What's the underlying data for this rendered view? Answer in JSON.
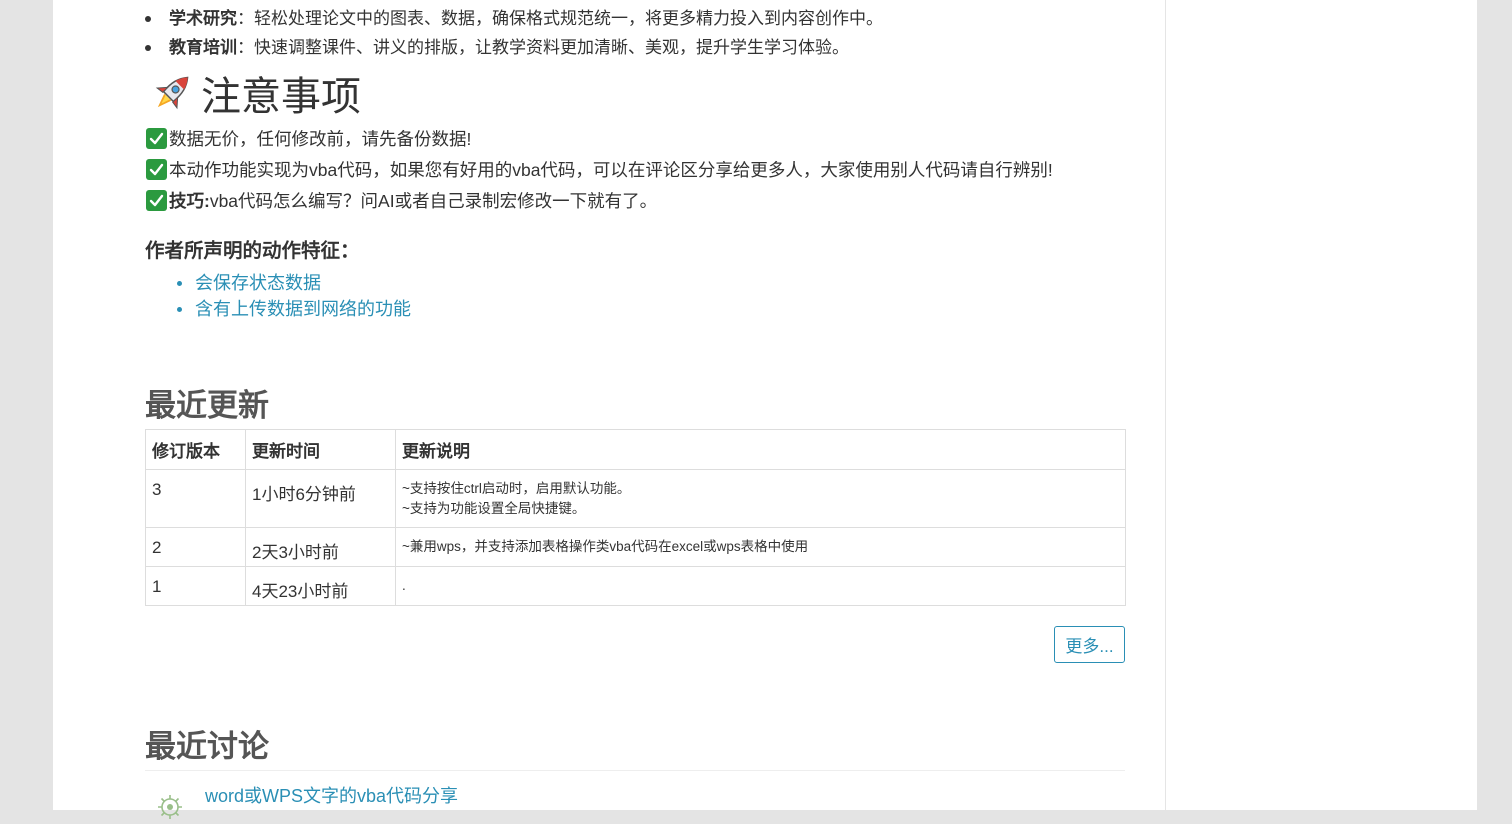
{
  "intro_bullets": [
    {
      "label": "学术研究",
      "text": "：轻松处理论文中的图表、数据，确保格式规范统一，将更多精力投入到内容创作中。"
    },
    {
      "label": "教育培训",
      "text": "：快速调整课件、讲义的排版，让教学资料更加清晰、美观，提升学生学习体验。"
    }
  ],
  "notice": {
    "title": "注意事项",
    "icon": "rocket-icon",
    "items": [
      {
        "bold": "",
        "text": "数据无价，任何修改前，请先备份数据!"
      },
      {
        "bold": "",
        "text": "本动作功能实现为vba代码，如果您有好用的vba代码，可以在评论区分享给更多人，大家使用别人代码请自行辨别!"
      },
      {
        "bold": "技巧:",
        "text": "vba代码怎么编写？问AI或者自己录制宏修改一下就有了。"
      }
    ]
  },
  "features": {
    "heading": "作者所声明的动作特征：",
    "items": [
      "会保存状态数据",
      "含有上传数据到网络的功能"
    ]
  },
  "recent_updates": {
    "title": "最近更新",
    "columns": [
      "修订版本",
      "更新时间",
      "更新说明"
    ],
    "rows": [
      {
        "version": "3",
        "time": "1小时6分钟前",
        "notes": [
          "~支持按住ctrl启动时，启用默认功能。",
          "~支持为功能设置全局快捷键。"
        ]
      },
      {
        "version": "2",
        "time": "2天3小时前",
        "notes": [
          "~兼用wps，并支持添加表格操作类vba代码在excel或wps表格中使用"
        ]
      },
      {
        "version": "1",
        "time": "4天23小时前",
        "notes": [
          "."
        ]
      }
    ],
    "more_label": "更多..."
  },
  "recent_discussions": {
    "title": "最近讨论",
    "items": [
      {
        "title": "word或WPS文字的vba代码分享",
        "avatar_icon": "avatar-icon"
      }
    ]
  },
  "colors": {
    "link": "#2a8fb5",
    "text": "#333333",
    "heading": "#555555",
    "check": "#2b9a3f",
    "page_bg": "#e4e4e4"
  }
}
